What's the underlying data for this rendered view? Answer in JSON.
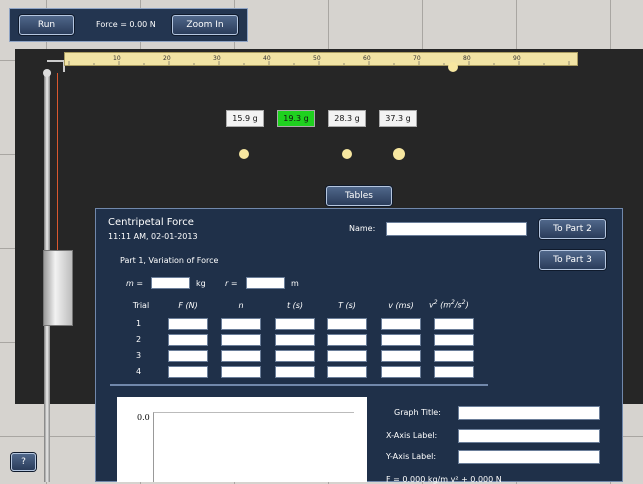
{
  "toolbar": {
    "run_label": "Run",
    "force_readout": "Force = 0.00 N",
    "zoom_label": "Zoom In"
  },
  "ruler": {
    "ticks": [
      "10",
      "20",
      "30",
      "40",
      "50",
      "60",
      "70",
      "80",
      "90"
    ]
  },
  "masses": [
    {
      "label": "15.9 g",
      "selected": false
    },
    {
      "label": "19.3 g",
      "selected": true
    },
    {
      "label": "28.3 g",
      "selected": false
    },
    {
      "label": "37.3 g",
      "selected": false
    }
  ],
  "tables_tab": "Tables",
  "panel": {
    "title": "Centripetal Force",
    "timestamp": "11:11 AM, 02-01-2013",
    "name_label": "Name:",
    "to_part2": "To Part 2",
    "to_part3": "To Part 3",
    "part_title": "Part 1, Variation of Force",
    "m_label": "m =",
    "m_unit": "kg",
    "r_label": "r =",
    "r_unit": "m",
    "col_headers": [
      "Trial",
      "F (N)",
      "n",
      "t (s)",
      "T (s)",
      "v (ms)"
    ],
    "v2_header": "v",
    "v2_sup": "2",
    "v2_units": "(m",
    "v2_units_sup": "2",
    "v2_units_rest": "/s",
    "v2_units_sup2": "2",
    "v2_units_end": ")",
    "trials": [
      "1",
      "2",
      "3",
      "4"
    ],
    "graph_title_label": "Graph Title:",
    "x_axis_label": "X-Axis Label:",
    "y_axis_label": "Y-Axis Label:",
    "fit_equation": "F = 0.000 kg/m v² + 0.000 N",
    "graph_y_tick": "0.0"
  },
  "help_label": "?",
  "colors": {
    "board": "#262626",
    "panel": "#1f3049",
    "selected_mass": "#1fd11f",
    "string": "#d9572f"
  }
}
